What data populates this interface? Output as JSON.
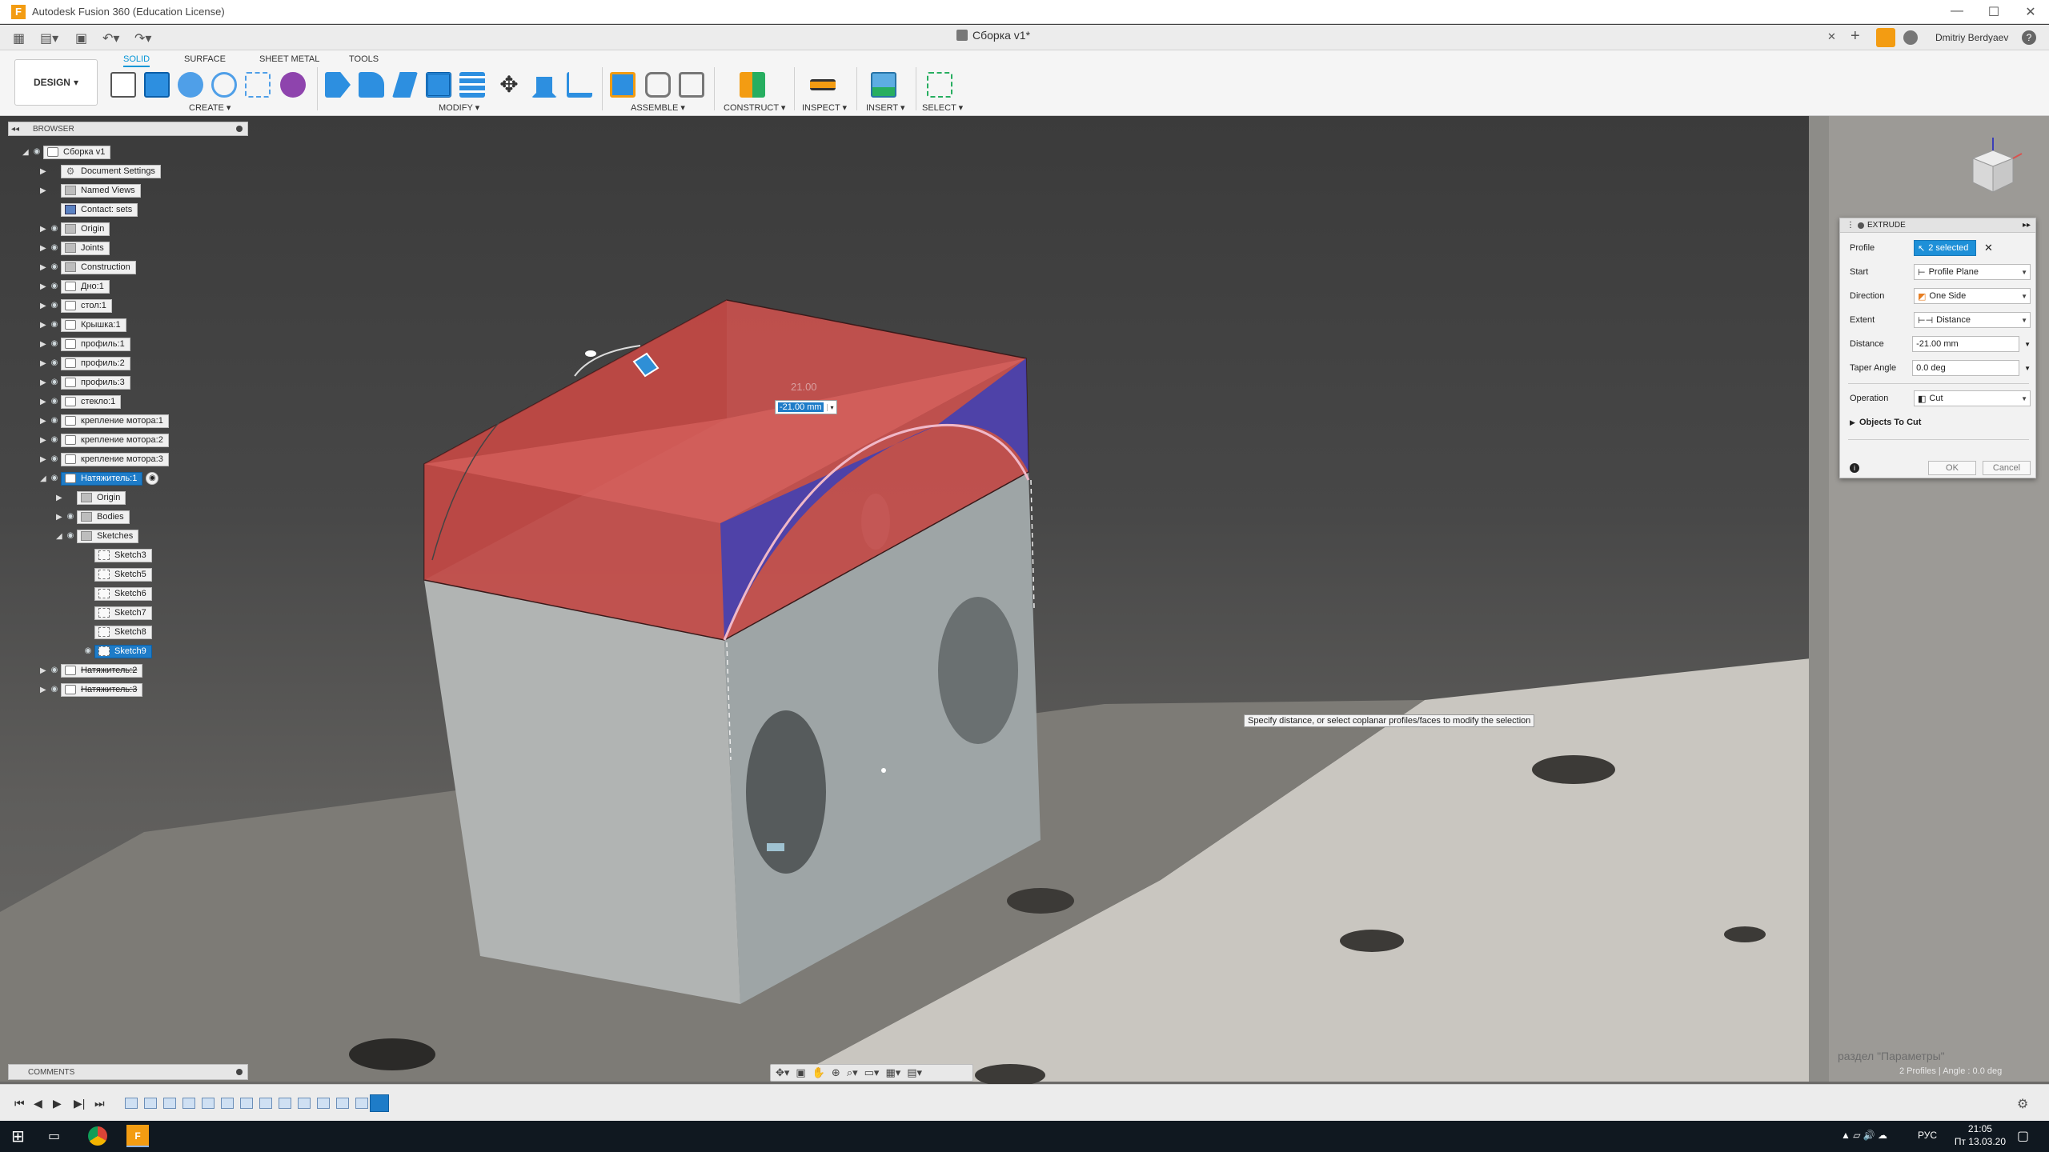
{
  "window": {
    "title": "Autodesk Fusion 360 (Education License)",
    "logo_letter": "F",
    "controls": [
      "—",
      "☐",
      "✕"
    ]
  },
  "quickbar": {
    "doc_tab": "Сборка v1*",
    "user": "Dmitriy Berdyaev",
    "help": "?",
    "close_tab": "✕",
    "add_tab": "+"
  },
  "ribbon": {
    "workspace": "DESIGN",
    "tabs": [
      "SOLID",
      "SURFACE",
      "SHEET METAL",
      "TOOLS"
    ],
    "active_tab": "SOLID",
    "groups": [
      "CREATE ▾",
      "MODIFY ▾",
      "ASSEMBLE ▾",
      "CONSTRUCT ▾",
      "INSPECT ▾",
      "INSERT ▾",
      "SELECT ▾"
    ]
  },
  "browser": {
    "title": "BROWSER",
    "items": [
      {
        "label": "Сборка v1",
        "icon": "comp",
        "level": 0,
        "arrow": "◢",
        "eye": true,
        "sel": false,
        "dash": false
      },
      {
        "label": "Document Settings",
        "icon": "gear",
        "level": 1,
        "arrow": "▶",
        "eye": false,
        "sel": false,
        "dash": false
      },
      {
        "label": "Named Views",
        "icon": "folder",
        "level": 1,
        "arrow": "▶",
        "eye": false,
        "sel": false,
        "dash": false
      },
      {
        "label": "Contact: sets",
        "icon": "contact",
        "level": 1,
        "arrow": "",
        "eye": false,
        "sel": false,
        "dash": false
      },
      {
        "label": "Origin",
        "icon": "folder",
        "level": 1,
        "arrow": "▶",
        "eye": true,
        "sel": false,
        "dash": false
      },
      {
        "label": "Joints",
        "icon": "folder",
        "level": 1,
        "arrow": "▶",
        "eye": true,
        "sel": false,
        "dash": false
      },
      {
        "label": "Construction",
        "icon": "folder",
        "level": 1,
        "arrow": "▶",
        "eye": true,
        "sel": false,
        "dash": false
      },
      {
        "label": "Дно:1",
        "icon": "comp",
        "level": 1,
        "arrow": "▶",
        "eye": true,
        "sel": false,
        "dash": false
      },
      {
        "label": "стол:1",
        "icon": "comp",
        "level": 1,
        "arrow": "▶",
        "eye": true,
        "sel": false,
        "dash": false
      },
      {
        "label": "Крышка:1",
        "icon": "comp",
        "level": 1,
        "arrow": "▶",
        "eye": true,
        "sel": false,
        "dash": false
      },
      {
        "label": "профиль:1",
        "icon": "comp",
        "level": 1,
        "arrow": "▶",
        "eye": true,
        "sel": false,
        "dash": false
      },
      {
        "label": "профиль:2",
        "icon": "comp",
        "level": 1,
        "arrow": "▶",
        "eye": true,
        "sel": false,
        "dash": false
      },
      {
        "label": "профиль:3",
        "icon": "comp",
        "level": 1,
        "arrow": "▶",
        "eye": true,
        "sel": false,
        "dash": false
      },
      {
        "label": "стекло:1",
        "icon": "comp",
        "level": 1,
        "arrow": "▶",
        "eye": true,
        "sel": false,
        "dash": false
      },
      {
        "label": "крепление мотора:1",
        "icon": "comp",
        "level": 1,
        "arrow": "▶",
        "eye": true,
        "sel": false,
        "dash": false
      },
      {
        "label": "крепление мотора:2",
        "icon": "comp",
        "level": 1,
        "arrow": "▶",
        "eye": true,
        "sel": false,
        "dash": false
      },
      {
        "label": "крепление мотора:3",
        "icon": "comp",
        "level": 1,
        "arrow": "▶",
        "eye": true,
        "sel": false,
        "dash": false
      },
      {
        "label": "Натяжитель:1",
        "icon": "comp",
        "level": 1,
        "arrow": "◢",
        "eye": true,
        "sel": true,
        "dash": false
      },
      {
        "label": "Origin",
        "icon": "folder",
        "level": 2,
        "arrow": "▶",
        "eye": false,
        "sel": false,
        "dash": false
      },
      {
        "label": "Bodies",
        "icon": "folder",
        "level": 2,
        "arrow": "▶",
        "eye": true,
        "sel": false,
        "dash": false
      },
      {
        "label": "Sketches",
        "icon": "folder",
        "level": 2,
        "arrow": "◢",
        "eye": true,
        "sel": false,
        "dash": false
      },
      {
        "label": "Sketch3",
        "icon": "sketch",
        "level": 3,
        "arrow": "",
        "eye": false,
        "sel": false,
        "dash": false
      },
      {
        "label": "Sketch5",
        "icon": "sketch",
        "level": 3,
        "arrow": "",
        "eye": false,
        "sel": false,
        "dash": false
      },
      {
        "label": "Sketch6",
        "icon": "sketch",
        "level": 3,
        "arrow": "",
        "eye": false,
        "sel": false,
        "dash": false
      },
      {
        "label": "Sketch7",
        "icon": "sketch",
        "level": 3,
        "arrow": "",
        "eye": false,
        "sel": false,
        "dash": false
      },
      {
        "label": "Sketch8",
        "icon": "sketch",
        "level": 3,
        "arrow": "",
        "eye": false,
        "sel": false,
        "dash": false
      },
      {
        "label": "Sketch9",
        "icon": "sketch",
        "level": 3,
        "arrow": "",
        "eye": true,
        "sel": true,
        "dash": false
      },
      {
        "label": "Натяжитель:2",
        "icon": "comp",
        "level": 1,
        "arrow": "▶",
        "eye": true,
        "sel": false,
        "dash": true
      },
      {
        "label": "Натяжитель:3",
        "icon": "comp",
        "level": 1,
        "arrow": "▶",
        "eye": true,
        "sel": false,
        "dash": true
      }
    ]
  },
  "extrude": {
    "title": "EXTRUDE",
    "profile_label": "Profile",
    "profile_value": "2 selected",
    "start_label": "Start",
    "start_value": "Profile Plane",
    "direction_label": "Direction",
    "direction_value": "One Side",
    "extent_label": "Extent",
    "extent_value": "Distance",
    "distance_label": "Distance",
    "distance_value": "-21.00 mm",
    "taper_label": "Taper Angle",
    "taper_value": "0.0 deg",
    "operation_label": "Operation",
    "operation_value": "Cut",
    "objects_label": "Objects To Cut",
    "ok": "OK",
    "cancel": "Cancel"
  },
  "viewport": {
    "dim_label": "21.00",
    "dim_input": "-21.00 mm",
    "tooltip": "Specify distance, or select coplanar profiles/faces to modify the selection",
    "status": "2 Profiles | Angle : 0.0 deg",
    "watermark": "раздел \"Параметры\""
  },
  "comments": {
    "title": "COMMENTS"
  },
  "taskbar": {
    "time": "21:05",
    "date": "Пт 13.03.20",
    "lang": "РУС"
  },
  "colors": {
    "accent": "#0696d7",
    "extrude_red": "#d9534f",
    "extrude_blue": "#3b3fb8"
  }
}
